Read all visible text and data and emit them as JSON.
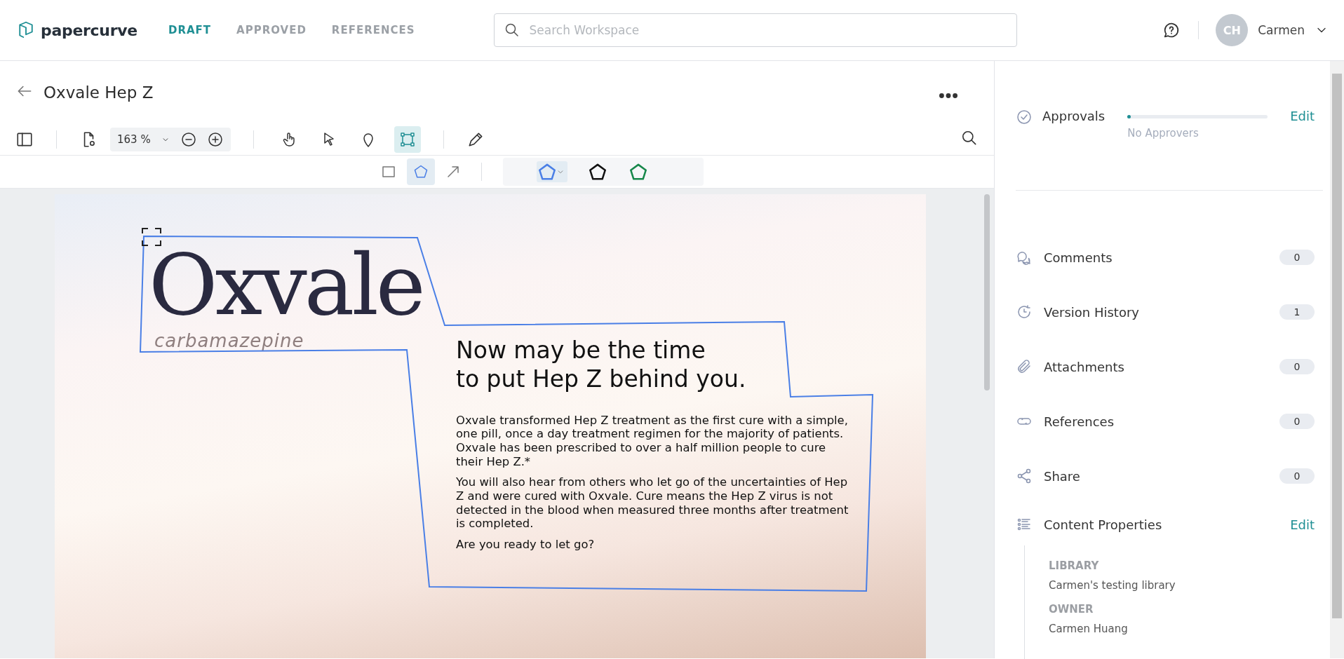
{
  "header": {
    "logo_text": "papercurve",
    "nav": [
      {
        "label": "DRAFT",
        "selected": true
      },
      {
        "label": "APPROVED",
        "selected": false
      },
      {
        "label": "REFERENCES",
        "selected": false
      }
    ],
    "search": {
      "placeholder": "Search Workspace"
    },
    "user": {
      "initials": "CH",
      "name": "Carmen"
    }
  },
  "viewer": {
    "title": "Oxvale Hep Z",
    "zoom": "163 %",
    "tools": [
      {
        "kind": "hand",
        "selected": false
      },
      {
        "kind": "pointer",
        "selected": false
      },
      {
        "kind": "pin",
        "selected": false
      },
      {
        "kind": "crop",
        "selected": true
      }
    ],
    "shapes": [
      {
        "kind": "rectangle",
        "selected": false
      },
      {
        "kind": "polygon",
        "selected": true
      },
      {
        "kind": "arrow",
        "selected": false
      }
    ],
    "shape_colors": [
      {
        "color": "#4a7fe6",
        "selected": true
      },
      {
        "color": "#111111",
        "selected": false
      },
      {
        "color": "#16874a",
        "selected": false
      }
    ],
    "page": {
      "brand": "Oxvale",
      "generic": "carbamazepine",
      "headline": [
        "Now may be the time",
        "to put Hep Z behind you."
      ],
      "paragraphs": [
        "Oxvale transformed Hep Z treatment as the first cure with a simple, one pill, once a day treatment regimen for the majority of patients. Oxvale has been prescribed to over a half million people to cure their Hep Z.*",
        "You will also hear from others who let go of the uncertainties of Hep Z and were cured with Oxvale. Cure means the Hep Z virus is not detected in the blood when measured three months after treatment is completed.",
        "Are you ready to let go?"
      ]
    }
  },
  "sidebar": {
    "approvals": {
      "label": "Approvals",
      "level": 0,
      "status": "No Approvers",
      "action": "Edit"
    },
    "items": [
      {
        "kind": "comments",
        "label": "Comments",
        "count": "0"
      },
      {
        "kind": "history",
        "label": "Version History",
        "count": "1"
      },
      {
        "kind": "attachments",
        "label": "Attachments",
        "count": "0"
      },
      {
        "kind": "references",
        "label": "References",
        "count": "0"
      },
      {
        "kind": "share",
        "label": "Share",
        "count": "0"
      }
    ],
    "content_properties": {
      "label": "Content Properties",
      "action": "Edit",
      "fields": [
        {
          "label": "LIBRARY",
          "value": "Carmen's testing library"
        },
        {
          "label": "OWNER",
          "value": "Carmen Huang"
        }
      ]
    }
  }
}
